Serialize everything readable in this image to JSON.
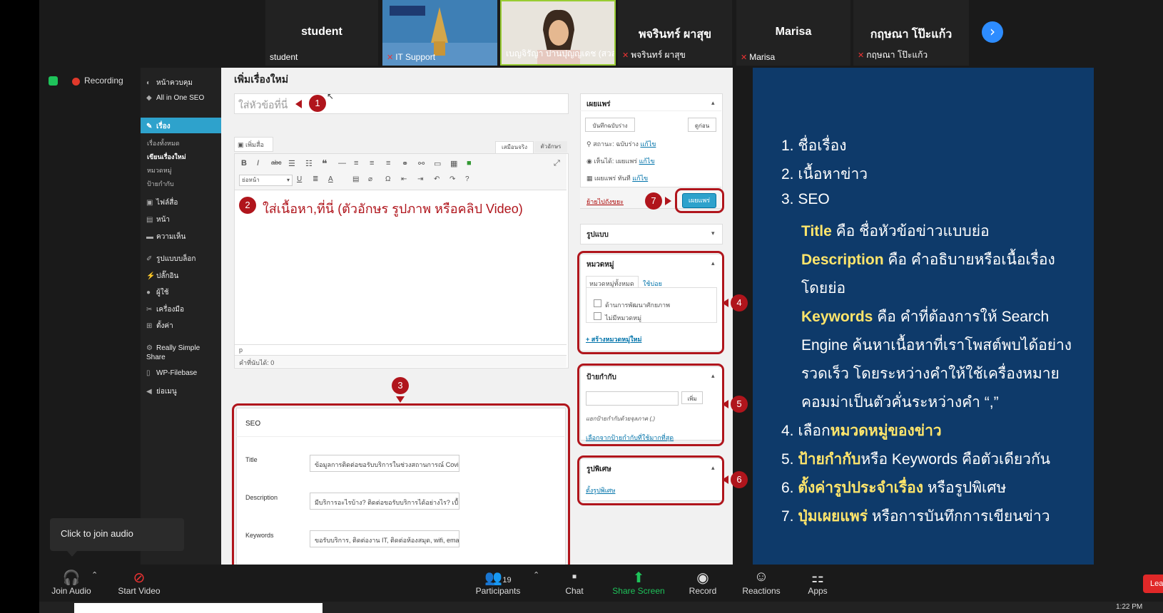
{
  "participants": [
    {
      "name": "student",
      "label": "student",
      "muted": false,
      "video": false
    },
    {
      "name": "",
      "label": "IT Support",
      "muted": true,
      "video": true
    },
    {
      "name": "",
      "label": "เบญจิรัญา ปานปุญญเดช (สวส)",
      "muted": false,
      "video": true
    },
    {
      "name": "พจรินทร์ ผาสุข",
      "label": "พจรินทร์ ผาสุข",
      "muted": true,
      "video": false
    },
    {
      "name": "Marisa",
      "label": "Marisa",
      "muted": true,
      "video": false
    },
    {
      "name": "กฤษณา โป๊ะแก้ว",
      "label": "กฤษณา โป๊ะแก้ว",
      "muted": true,
      "video": false
    }
  ],
  "recording_label": "Recording",
  "audio_tooltip": "Click to join audio",
  "wp": {
    "menu": [
      "หน้าควบคุม",
      "All in One SEO",
      "เรื่อง",
      "ไฟล์สื่อ",
      "หน้า",
      "ความเห็น",
      "รูปแบบบล็อก",
      "ปลั๊กอิน",
      "ผู้ใช้",
      "เครื่องมือ",
      "ตั้งค่า",
      "Really Simple Share",
      "WP-Filebase",
      "ย่อเมนู"
    ],
    "submenu": [
      "เรื่องทั้งหมด",
      "เขียนเรื่องใหม่",
      "หมวดหมู่",
      "ป้ายกำกับ"
    ],
    "page_title": "เพิ่มเรื่องใหม่",
    "title_placeholder": "ใส่หัวข้อที่นี่",
    "add_media": "เพิ่มสื่อ",
    "tab_visual": "เสมือนจริง",
    "tab_text": "ตัวอักษร",
    "format_select": "ย่อหน้า",
    "content_hint": "ใส่เนื้อหา,ที่นี่ (ตัวอักษร รูปภาพ หรือคลิป Video)",
    "path": "p",
    "word_count": "คำที่นับได้: 0",
    "seo": {
      "heading": "SEO",
      "title_label": "Title",
      "title_value": "ข้อมูลการติดต่อขอรับบริการในช่วงสถานการณ์ Covid-1!",
      "desc_label": "Description",
      "desc_value": "มีบริการอะไรบ้าง? ติดต่อขอรับบริการได้อย่างไร? เบื้องต้",
      "kw_label": "Keywords",
      "kw_value": "ขอรับบริการ, ติดต่องาน IT, ติดต่อห้องสมุด, wifi, email,"
    },
    "publish": {
      "heading": "เผยแพร่",
      "save_draft": "บันทึกฉบับร่าง",
      "preview": "ดูก่อน",
      "status": "สถานะ: ฉบับร่าง",
      "visibility": "เห็นได้: เผยแพร่",
      "schedule": "เผยแพร่ ทันที",
      "edit": "แก้ไข",
      "trash": "ย้ายไปถังขยะ",
      "publish_btn": "เผยแพร่"
    },
    "format_heading": "รูปแบบ",
    "categories": {
      "heading": "หมวดหมู่",
      "tab_all": "หมวดหมู่ทั้งหมด",
      "tab_used": "ใช้บ่อย",
      "items": [
        "ด้านการพัฒนาศักยภาพ",
        "ไม่มีหมวดหมู่"
      ],
      "add_new": "+ สร้างหมวดหมู่ใหม่"
    },
    "tags": {
      "heading": "ป้ายกำกับ",
      "add_btn": "เพิ่ม",
      "hint": "แยกป้ายกำกับด้วยจุลภาค (,)",
      "choose": "เลือกจากป้ายกำกับที่ใช้มากที่สุด"
    },
    "featured": {
      "heading": "รูปพิเศษ",
      "set": "ตั้งรูปพิเศษ"
    }
  },
  "annotations": [
    "1",
    "2",
    "3",
    "4",
    "5",
    "6",
    "7"
  ],
  "slide": {
    "l1": "1. ชื่อเรื่อง",
    "l2": "2. เนื้อหาข่าว",
    "l3": "3. SEO",
    "title_kw": "Title",
    "title_rest": " คือ ชื่อหัวข้อข่าวแบบย่อ",
    "desc_kw": "Description",
    "desc_rest": " คือ คำอธิบายหรือเนื้อเรื่อง",
    "desc_rest2": "โดยย่อ",
    "kw_kw": "Keywords",
    "kw_rest": " คือ คำที่ต้องการให้ Search",
    "kw2": "Engine ค้นหาเนื้อหาที่เราโพสต์พบได้อย่าง",
    "kw3": "รวดเร็ว โดยระหว่างคำให้ใช้เครื่องหมาย",
    "kw4": "คอมม่าเป็นตัวคั่นระหว่างคำ  “,”",
    "l4a": "4. เลือก",
    "l4b": "หมวดหมู่ของข่าว",
    "l5a": "5. ",
    "l5b": "ป้ายกำกับ",
    "l5c": "หรือ Keywords คือตัวเดียวกัน",
    "l6a": "6. ",
    "l6b": "ตั้งค่ารูปประจำเรื่อง",
    "l6c": " หรือรูปพิเศษ",
    "l7a": "7. ",
    "l7b": "ปุ่มเผยแพร่",
    "l7c": " หรือการบันทึกการเขียนข่าว"
  },
  "toolbar": {
    "join_audio": "Join Audio",
    "start_video": "Start Video",
    "participants": "Participants",
    "participants_count": "19",
    "chat": "Chat",
    "share_screen": "Share Screen",
    "record": "Record",
    "reactions": "Reactions",
    "apps": "Apps",
    "leave": "Lea"
  },
  "clock": "1:22 PM",
  "colors": {
    "accent": "#b0151c",
    "slide_bg": "#0e3a6a",
    "highlight": "#ffe56b",
    "zoom_blue": "#2d8cff",
    "share_green": "#1ec35a"
  }
}
